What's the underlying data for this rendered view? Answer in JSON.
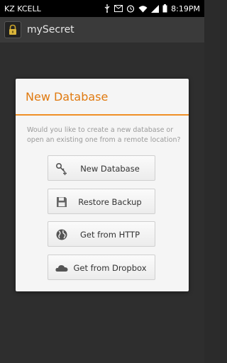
{
  "status_bar": {
    "carrier": "KZ KCELL",
    "time": "8:19PM",
    "icons": [
      "usb-icon",
      "mail-icon",
      "alarm-icon",
      "wifi-icon",
      "signal-icon",
      "battery-icon"
    ]
  },
  "action_bar": {
    "app_icon": "lock-icon",
    "title": "mySecret"
  },
  "dialog": {
    "title": "New Database",
    "message": "Would you like to create a new database or open an existing one from a remote location?",
    "accent_color": "#ef8f26",
    "options": [
      {
        "label": "New Database",
        "icon": "key-add-icon"
      },
      {
        "label": "Restore Backup",
        "icon": "floppy-disk-icon"
      },
      {
        "label": "Get from HTTP",
        "icon": "globe-icon"
      },
      {
        "label": "Get from Dropbox",
        "icon": "cloud-icon"
      }
    ]
  }
}
